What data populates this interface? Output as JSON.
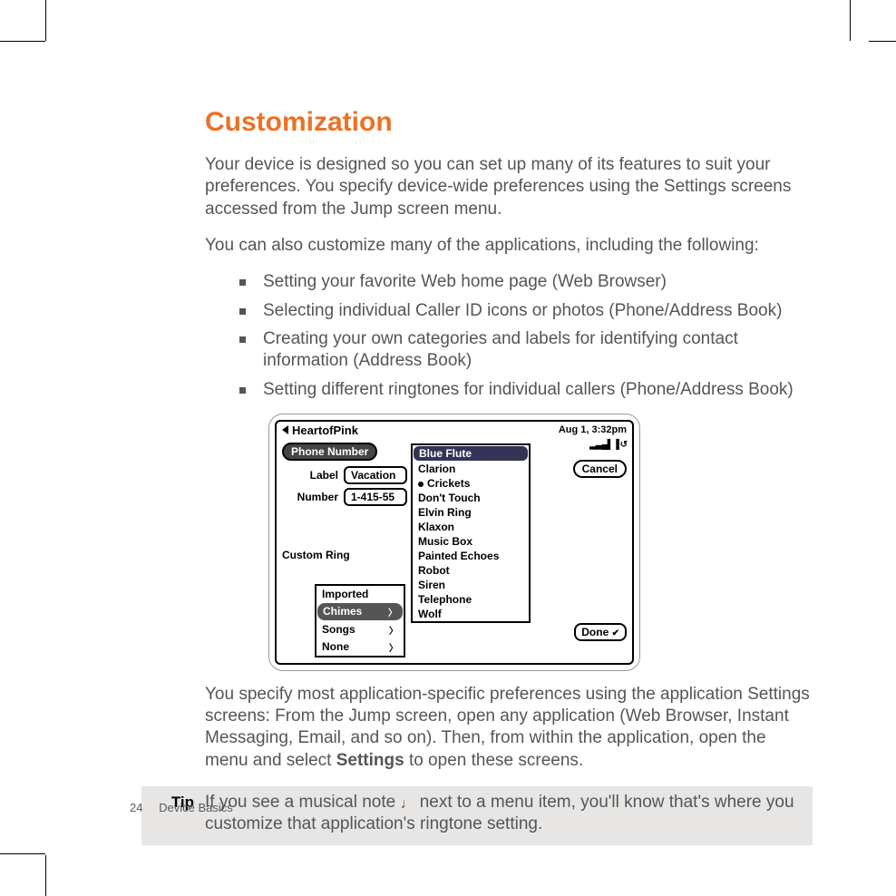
{
  "heading": "Customization",
  "para1": "Your device is designed so you can set up many of its features to suit your preferences. You specify device-wide preferences using the Settings screens accessed from the Jump screen menu.",
  "para2": "You can also customize many of the applications, including the following:",
  "bullets": [
    "Setting your favorite Web home page (Web Browser)",
    "Selecting individual Caller ID icons or photos (Phone/Address Book)",
    "Creating your own categories and labels for identifying contact information (Address Book)",
    "Setting different ringtones for individual callers (Phone/Address Book)"
  ],
  "para3a": "You specify most application-specific preferences using the application Settings screens: From the Jump screen, open any application (Web Browser, Instant Messaging, Email, and so on). Then, from within the application, open the menu and select",
  "para3bold": "Settings",
  "para3b": "to open these screens.",
  "tip": {
    "label": "Tip",
    "text1": "If you see a musical note",
    "text2": "next to a menu item, you'll know that's where you customize that application's ringtone setting."
  },
  "screenshot": {
    "title": "HeartofPink",
    "datetime": "Aug 1, 3:32pm",
    "signal": "▂▃▄▌▐ ↺",
    "section": "Phone Number",
    "cancel": "Cancel",
    "label_label": "Label",
    "label_value": "Vacation",
    "number_label": "Number",
    "number_value": "1-415-55",
    "custom_ring": "Custom Ring",
    "categories": [
      "Imported",
      "Chimes",
      "Songs",
      "None"
    ],
    "tones": [
      "Blue Flute",
      "Clarion",
      "Crickets",
      "Don't Touch",
      "Elvin Ring",
      "Klaxon",
      "Music Box",
      "Painted Echoes",
      "Robot",
      "Siren",
      "Telephone",
      "Wolf"
    ],
    "done": "Done"
  },
  "footer": {
    "page": "24",
    "section": "Device Basics"
  }
}
